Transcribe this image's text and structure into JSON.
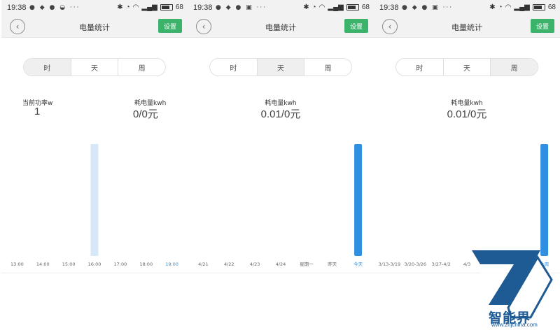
{
  "status_bar": [
    {
      "time": "19:38",
      "battery": "68"
    },
    {
      "time": "19:38",
      "battery": "68"
    },
    {
      "time": "19:38",
      "battery": "68"
    }
  ],
  "header": {
    "title": "电量统计",
    "settings_label": "设置",
    "back_icon": "chevron-left-icon"
  },
  "tabs": [
    "时",
    "天",
    "周"
  ],
  "screens": [
    {
      "active_tab": 0,
      "stats": [
        {
          "label": "当前功率w",
          "value": "1"
        },
        {
          "label": "耗电量kwh",
          "value": "0/0元"
        }
      ]
    },
    {
      "active_tab": 1,
      "stats": [
        {
          "label": "耗电量kwh",
          "value": "0.01/0元"
        }
      ]
    },
    {
      "active_tab": 2,
      "stats": [
        {
          "label": "耗电量kwh",
          "value": "0.01/0元"
        }
      ]
    }
  ],
  "colors": {
    "accent_green": "#3bb36b",
    "bar_active": "#2f8fe0",
    "bar_light": "#d6e8f8",
    "selected_label": "#2f8fe0",
    "brand_blue": "#1e5a93"
  },
  "chart_data": [
    {
      "type": "bar",
      "categories": [
        "13:00",
        "14:00",
        "15:00",
        "16:00",
        "17:00",
        "18:00",
        "19:00"
      ],
      "values": [
        0,
        0,
        0,
        1,
        0,
        0,
        0
      ],
      "selected_index": 6,
      "highlight_style": "light"
    },
    {
      "type": "bar",
      "categories": [
        "4/21",
        "4/22",
        "4/23",
        "4/24",
        "星期一",
        "昨天",
        "今天"
      ],
      "values": [
        0,
        0,
        0,
        0,
        0,
        0,
        1
      ],
      "selected_index": 6,
      "highlight_style": "solid"
    },
    {
      "type": "bar",
      "categories": [
        "3/13-3/19",
        "3/20-3/26",
        "3/27-4/2",
        "4/3",
        "",
        "",
        "本周"
      ],
      "values": [
        0,
        0,
        0,
        0,
        0,
        0,
        1
      ],
      "selected_index": 6,
      "highlight_style": "solid"
    }
  ],
  "watermark": {
    "name": "智能界",
    "url": "www.znjchina.com"
  }
}
